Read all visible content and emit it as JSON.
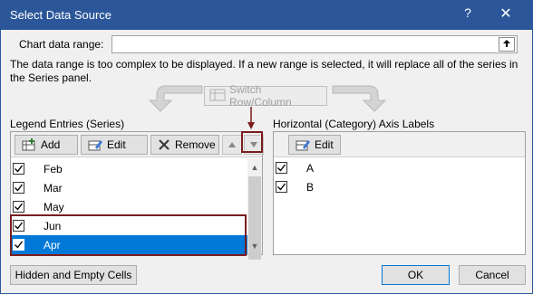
{
  "window": {
    "title": "Select Data Source",
    "help": "?",
    "close": "✕"
  },
  "range": {
    "label": "Chart data range:",
    "value": "",
    "collapse_icon": "collapse-range-icon"
  },
  "info_text": "The data range is too complex to be displayed. If a new range is selected, it will replace all of the series in the Series panel.",
  "switch_button": {
    "label": "Switch Row/Column",
    "enabled": false
  },
  "legend": {
    "title": "Legend Entries (Series)",
    "add_label": "Add",
    "edit_label": "Edit",
    "remove_label": "Remove",
    "move_up": "move-up-icon",
    "move_down": "move-down-icon",
    "items": [
      {
        "label": "Feb",
        "checked": true,
        "selected": false
      },
      {
        "label": "Mar",
        "checked": true,
        "selected": false
      },
      {
        "label": "May",
        "checked": true,
        "selected": false
      },
      {
        "label": "Jun",
        "checked": true,
        "selected": false
      },
      {
        "label": "Apr",
        "checked": true,
        "selected": true
      }
    ]
  },
  "axis": {
    "title": "Horizontal (Category) Axis Labels",
    "edit_label": "Edit",
    "items": [
      {
        "label": "A",
        "checked": true
      },
      {
        "label": "B",
        "checked": true
      }
    ]
  },
  "buttons": {
    "hidden_cells": "Hidden and Empty Cells",
    "ok": "OK",
    "cancel": "Cancel"
  },
  "colors": {
    "title_bar": "#2b579a",
    "selection": "#0078d7",
    "highlight": "#7a1c1c"
  }
}
